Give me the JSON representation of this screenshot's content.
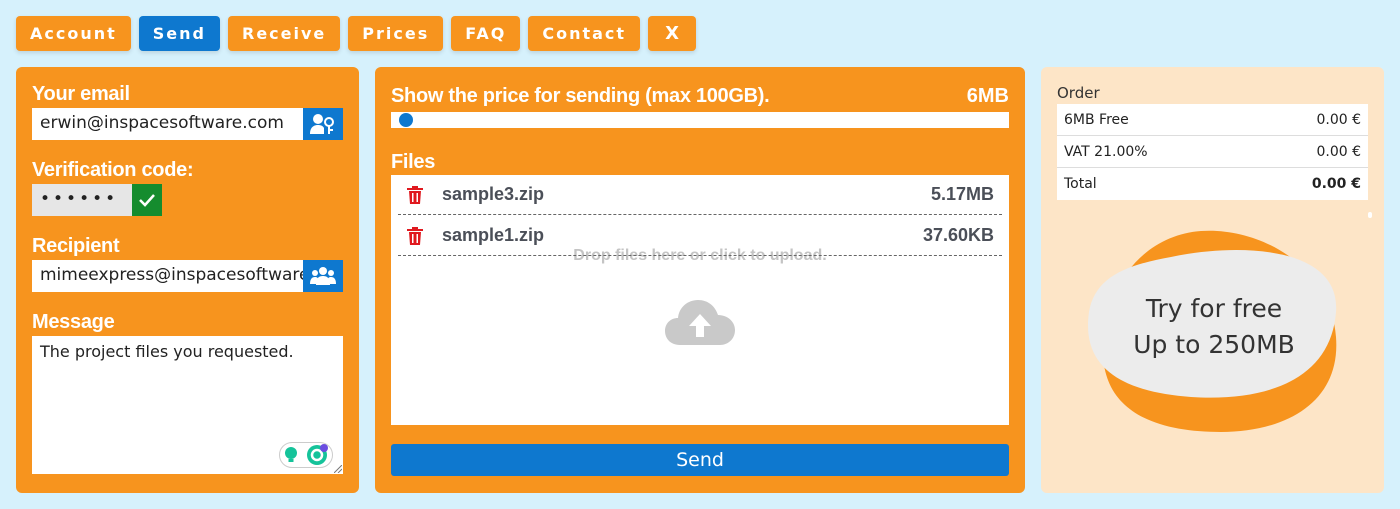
{
  "nav": {
    "items": [
      {
        "label": "Account",
        "active": false
      },
      {
        "label": "Send",
        "active": true
      },
      {
        "label": "Receive",
        "active": false
      },
      {
        "label": "Prices",
        "active": false
      },
      {
        "label": "FAQ",
        "active": false
      },
      {
        "label": "Contact",
        "active": false
      },
      {
        "label": "X",
        "active": false
      }
    ]
  },
  "form": {
    "email_label": "Your email",
    "email_value": "erwin@inspacesoftware.com",
    "code_label": "Verification code:",
    "code_value": "••••••",
    "recipient_label": "Recipient",
    "recipient_value": "mimeexpress@inspacesoftware",
    "message_label": "Message",
    "message_value": "The project files you requested."
  },
  "upload": {
    "price_label": "Show the price for sending (max 100GB).",
    "size_value": "6MB",
    "slider_fraction": 6e-05,
    "files_label": "Files",
    "files": [
      {
        "name": "sample3.zip",
        "size": "5.17MB"
      },
      {
        "name": "sample1.zip",
        "size": "37.60KB"
      }
    ],
    "drop_text": "Drop files here or click to upload.",
    "send_label": "Send"
  },
  "order": {
    "title": "Order",
    "rows": [
      {
        "label": "6MB Free",
        "value": "0.00 €"
      },
      {
        "label": "VAT 21.00%",
        "value": "0.00 €"
      },
      {
        "label": "Total",
        "value": "0.00 €"
      }
    ],
    "promo_line1": "Try for free",
    "promo_line2": "Up to 250MB"
  },
  "colors": {
    "orange": "#f7941e",
    "blue": "#0e78cf",
    "green": "#158c2e",
    "background": "#d6f1fc",
    "trash": "#e0191f"
  }
}
